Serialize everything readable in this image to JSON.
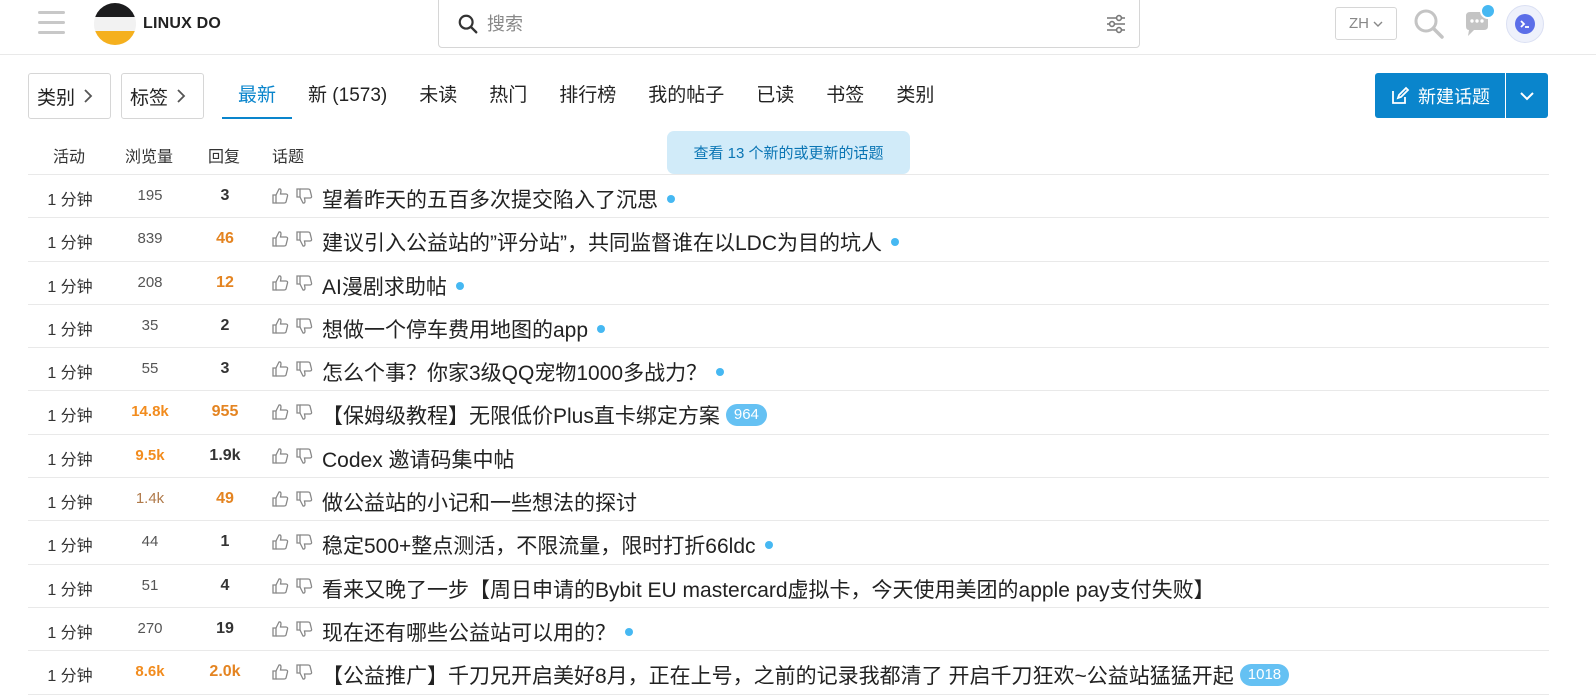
{
  "header": {
    "site_name": "LINUX DO",
    "search_placeholder": "搜索",
    "lang_label": "ZH"
  },
  "nav": {
    "category_dropdown": "类别",
    "tag_dropdown": "标签",
    "tabs": [
      "最新",
      "新 (1573)",
      "未读",
      "热门",
      "排行榜",
      "我的帖子",
      "已读",
      "书签",
      "类别"
    ],
    "active_tab": "最新",
    "new_topic_label": "新建话题"
  },
  "table": {
    "col_activity": "活动",
    "col_views": "浏览量",
    "col_replies": "回复",
    "col_topic": "话题",
    "new_banner": "查看 13 个新的或更新的话题"
  },
  "topics": [
    {
      "activity": "1 分钟",
      "views": "195",
      "replies": "3",
      "title": "望着昨天的五百多次提交陷入了沉思",
      "marker": "dot",
      "badge": ""
    },
    {
      "activity": "1 分钟",
      "views": "839",
      "replies": "46",
      "title": "建议引入公益站的”评分站”，共同监督谁在以LDC为目的坑人",
      "marker": "dot",
      "badge": ""
    },
    {
      "activity": "1 分钟",
      "views": "208",
      "replies": "12",
      "title": "AI漫剧求助帖",
      "marker": "dot",
      "badge": ""
    },
    {
      "activity": "1 分钟",
      "views": "35",
      "replies": "2",
      "title": "想做一个停车费用地图的app",
      "marker": "dot",
      "badge": ""
    },
    {
      "activity": "1 分钟",
      "views": "55",
      "replies": "3",
      "title": "怎么个事？你家3级QQ宠物1000多战力？",
      "marker": "dot",
      "badge": ""
    },
    {
      "activity": "1 分钟",
      "views": "14.8k",
      "replies": "955",
      "title": "【保姆级教程】无限低价Plus直卡绑定方案",
      "marker": "badge",
      "badge": "964"
    },
    {
      "activity": "1 分钟",
      "views": "9.5k",
      "replies": "1.9k",
      "title": "Codex 邀请码集中帖",
      "marker": "none",
      "badge": ""
    },
    {
      "activity": "1 分钟",
      "views": "1.4k",
      "replies": "49",
      "title": "做公益站的小记和一些想法的探讨",
      "marker": "none",
      "badge": ""
    },
    {
      "activity": "1 分钟",
      "views": "44",
      "replies": "1",
      "title": "稳定500+整点测活，不限流量，限时打折66ldc",
      "marker": "dot",
      "badge": ""
    },
    {
      "activity": "1 分钟",
      "views": "51",
      "replies": "4",
      "title": "看来又晚了一步【周日申请的Bybit EU mastercard虚拟卡，今天使用美团的apple pay支付失败】",
      "marker": "none",
      "badge": ""
    },
    {
      "activity": "1 分钟",
      "views": "270",
      "replies": "19",
      "title": "现在还有哪些公益站可以用的？",
      "marker": "dot",
      "badge": ""
    },
    {
      "activity": "1 分钟",
      "views": "8.6k",
      "replies": "2.0k",
      "title": "【公益推广】千刀兄开启美好8月，正在上号，之前的记录我都清了 开启千刀狂欢~公益站猛猛开起",
      "marker": "badge",
      "badge": "1018"
    }
  ],
  "colors": {
    "accent": "#0a85cc",
    "unread_dot": "#46b8f2",
    "hot_orange": "#e48421"
  }
}
